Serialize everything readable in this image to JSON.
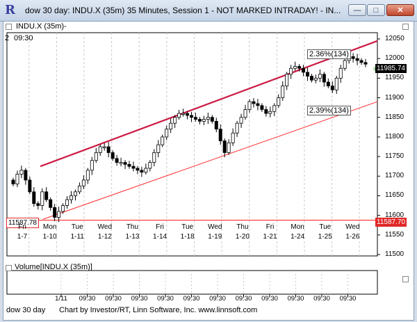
{
  "window": {
    "app_icon_glyph": "R",
    "title": "dow 30 day: INDU.X (35m) 35 Minutes, Session 1 - NOT MARKED INTRADAY! - IN...",
    "min_glyph": "—",
    "max_glyph": "□",
    "close_glyph": "✕"
  },
  "price_pane": {
    "header_label": "INDU.X (35m)-",
    "header_number": "2",
    "header_time": "09:30",
    "current_price": "11985.74",
    "current_marker_glyph": "✳",
    "support_price": "11587.70",
    "support_label_left": "11587.78",
    "upper_channel_label": "2.36%(134)",
    "lower_channel_label": "2.39%(134)"
  },
  "volume_pane": {
    "header_label": "Volume[INDU.X (35m)]",
    "first_label": "1/11",
    "time_label": "09:30"
  },
  "footer": {
    "left": "dow 30 day",
    "right": "Chart by Investor/RT, Linn Software, Inc. www.linnsoft.com"
  },
  "colors": {
    "channel_upper": "#cc1a44",
    "channel_lower": "#ff2a2a",
    "support": "#ff3030",
    "grid": "#c8c8c8",
    "candle": "#000000"
  },
  "chart_data": {
    "type": "candlestick",
    "title": "INDU.X (35m)",
    "y_ticks": [
      12050,
      12000,
      11950,
      11900,
      11850,
      11800,
      11750,
      11700,
      11650,
      11600,
      11550,
      11500
    ],
    "ylim": [
      11500,
      12050
    ],
    "x_day_labels": [
      {
        "day": "Fri",
        "date": "1-7"
      },
      {
        "day": "Mon",
        "date": "1-10"
      },
      {
        "day": "Tue",
        "date": "1-11"
      },
      {
        "day": "Wed",
        "date": "1-12"
      },
      {
        "day": "Thu",
        "date": "1-13"
      },
      {
        "day": "Fri",
        "date": "1-14"
      },
      {
        "day": "Tue",
        "date": "1-18"
      },
      {
        "day": "Wed",
        "date": "1-19"
      },
      {
        "day": "Thu",
        "date": "1-20"
      },
      {
        "day": "Fri",
        "date": "1-21"
      },
      {
        "day": "Mon",
        "date": "1-24"
      },
      {
        "day": "Tue",
        "date": "1-25"
      },
      {
        "day": "Wed",
        "date": "1-26"
      }
    ],
    "closes": [
      11680,
      11705,
      11715,
      11690,
      11660,
      11630,
      11625,
      11660,
      11640,
      11620,
      11595,
      11610,
      11625,
      11640,
      11650,
      11660,
      11675,
      11690,
      11715,
      11740,
      11760,
      11775,
      11775,
      11760,
      11745,
      11735,
      11735,
      11730,
      11725,
      11720,
      11715,
      11710,
      11720,
      11735,
      11760,
      11780,
      11800,
      11820,
      11835,
      11850,
      11860,
      11860,
      11855,
      11850,
      11845,
      11840,
      11845,
      11850,
      11840,
      11820,
      11790,
      11760,
      11785,
      11810,
      11835,
      11850,
      11870,
      11890,
      11885,
      11880,
      11870,
      11860,
      11865,
      11880,
      11900,
      11930,
      11960,
      11975,
      11980,
      11975,
      11965,
      11955,
      11945,
      11950,
      11960,
      11940,
      11930,
      11920,
      11950,
      11975,
      11995,
      12005,
      12000,
      11995,
      11990,
      11985.74
    ],
    "channel_upper": {
      "start": 11725,
      "end": 12045
    },
    "channel_lower": {
      "start": 11590,
      "end": 11890
    },
    "support_level": 11587.7
  }
}
